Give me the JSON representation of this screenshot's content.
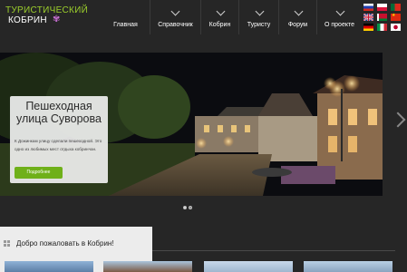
{
  "logo": {
    "line1": "ТУРИСТИЧЕСКИЙ",
    "line2": "КОБРИН",
    "flower_color": "#c86fd3"
  },
  "nav": {
    "items": [
      {
        "label": "Главная"
      },
      {
        "label": "Справочник"
      },
      {
        "label": "Кобрин"
      },
      {
        "label": "Туристу"
      },
      {
        "label": "Форум"
      },
      {
        "label": "О проекте"
      }
    ]
  },
  "languages": [
    "ru",
    "pl",
    "pt",
    "en",
    "by",
    "cn",
    "de",
    "it",
    "jp"
  ],
  "slider": {
    "title": "Пешеходная улица Суворова",
    "text": "К Дожинкам улицу сделали пешеходной. Это одно из любимых мест отдыха кобринчан.",
    "button_label": "Подробнее",
    "dots_count": 2,
    "active_dot": 0
  },
  "welcome": {
    "title": "Добро пожаловать в Кобрин!"
  },
  "colors": {
    "accent": "#6fb019",
    "logo_green": "#9ccf2c",
    "header_bg": "#262626"
  }
}
